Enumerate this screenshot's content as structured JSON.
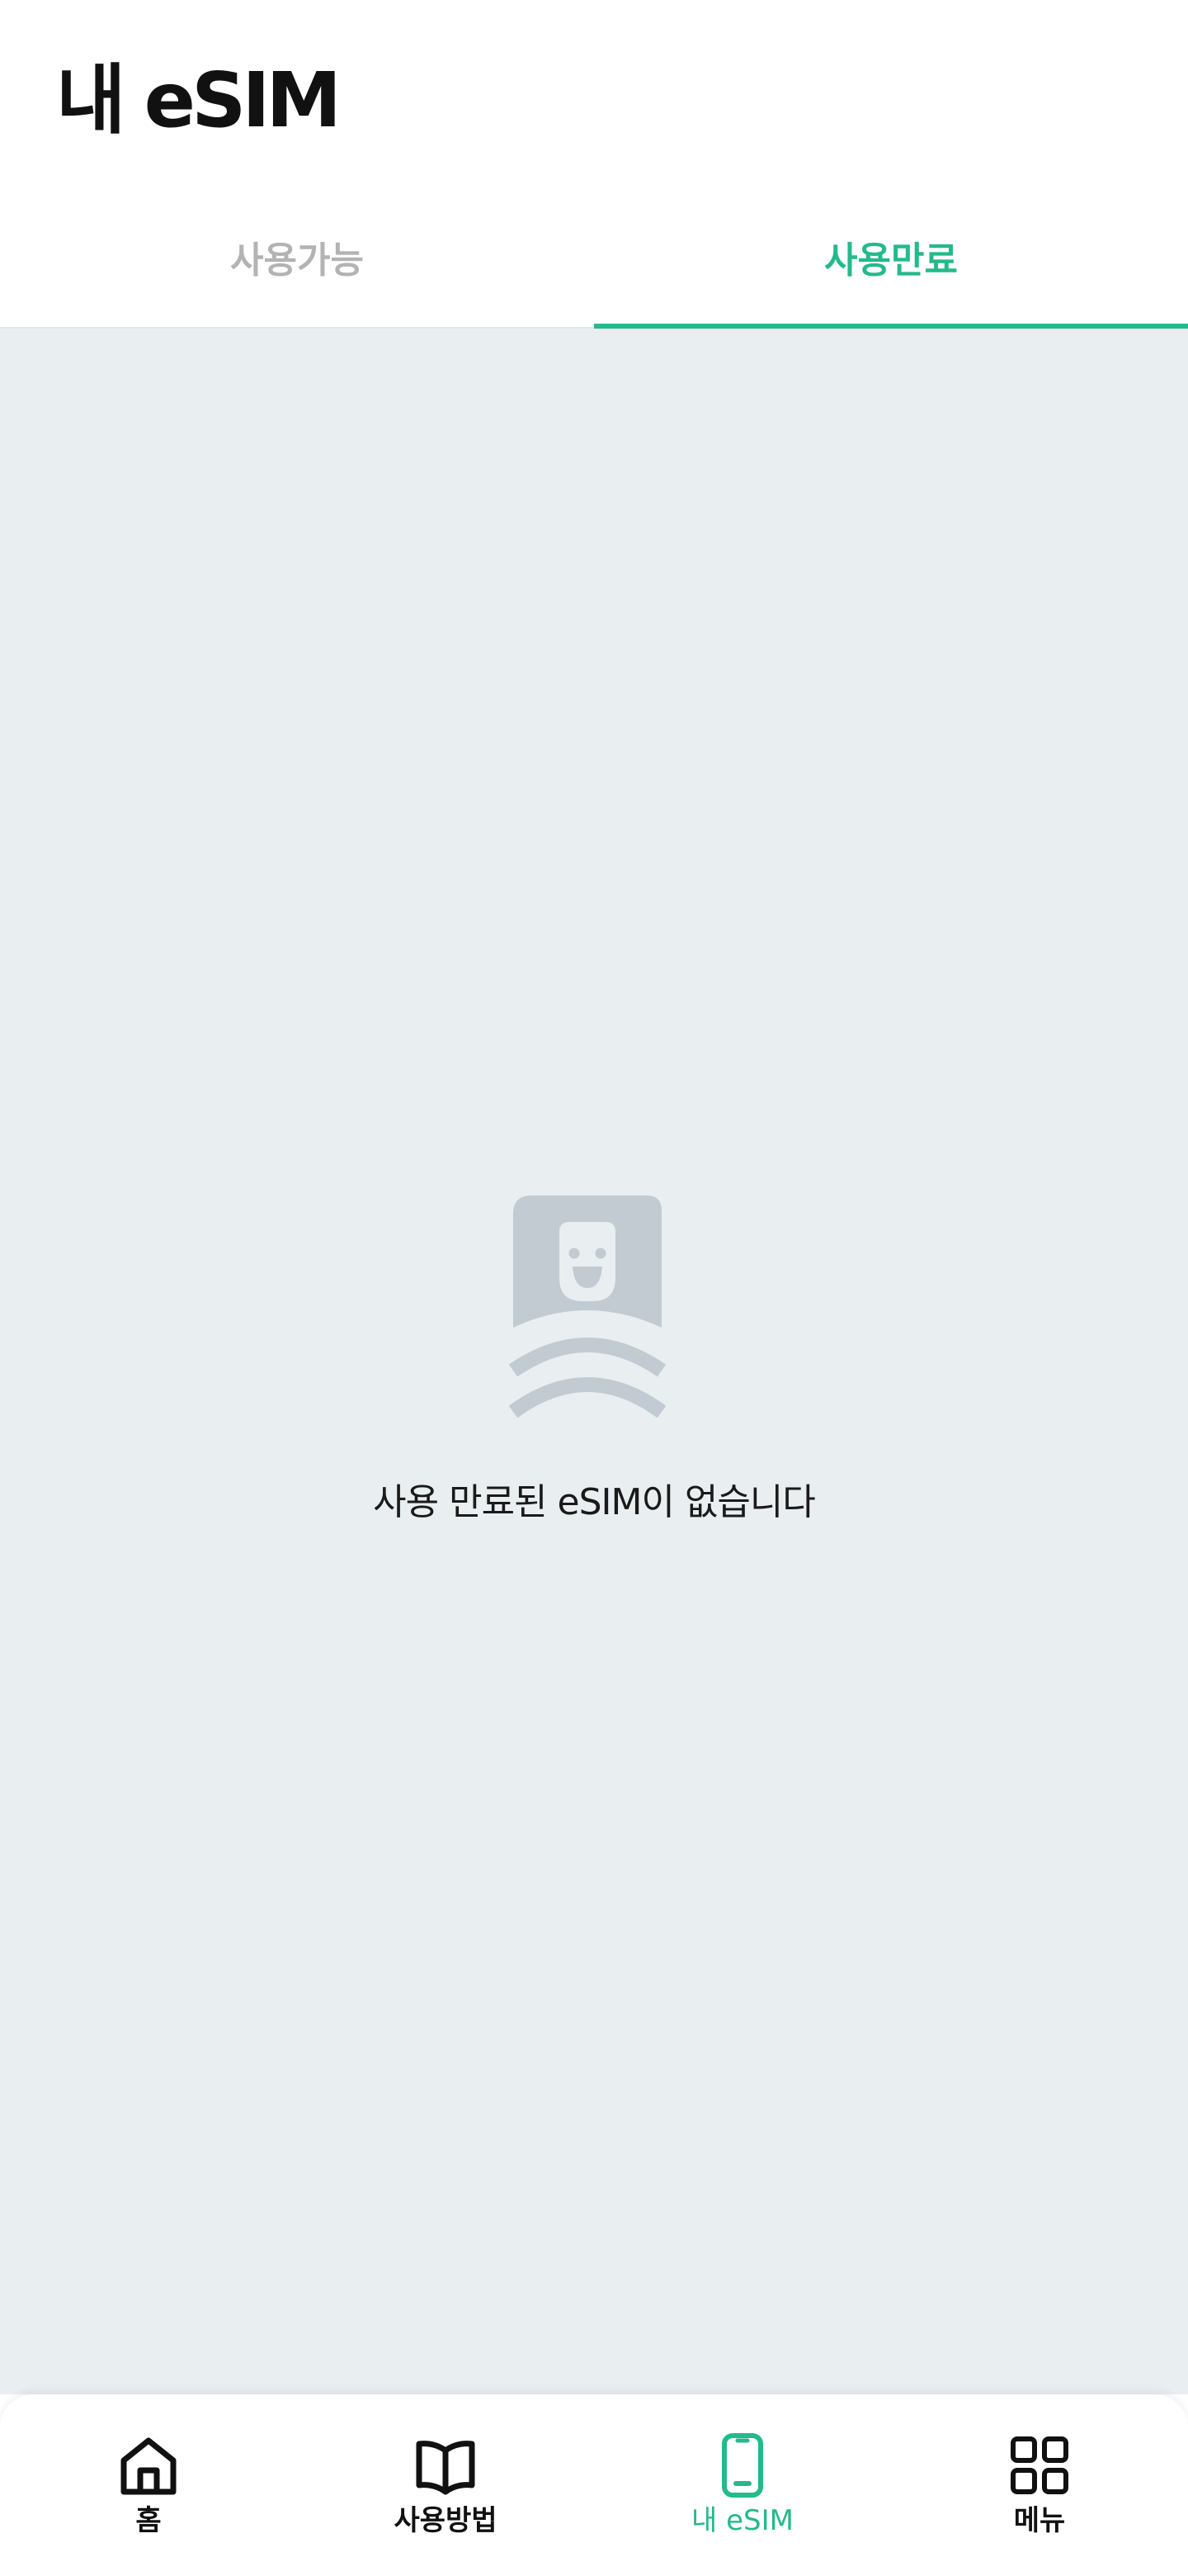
{
  "header": {
    "title": "내 eSIM"
  },
  "tabs": [
    {
      "label": "사용가능",
      "active": false
    },
    {
      "label": "사용만료",
      "active": true
    }
  ],
  "empty_state": {
    "icon": "esim-mascot-icon",
    "message": "사용 만료된 eSIM이 없습니다"
  },
  "bottom_nav": {
    "items": [
      {
        "label": "홈",
        "icon": "home-icon",
        "active": false
      },
      {
        "label": "사용방법",
        "icon": "book-icon",
        "active": false
      },
      {
        "label": "내 eSIM",
        "icon": "phone-icon",
        "active": true
      },
      {
        "label": "메뉴",
        "icon": "grid-icon",
        "active": false
      }
    ]
  },
  "colors": {
    "accent": "#25b98c",
    "inactive_tab": "#b3b3b3",
    "content_background": "#e9eef1",
    "illustration": "#c2cbd1"
  }
}
